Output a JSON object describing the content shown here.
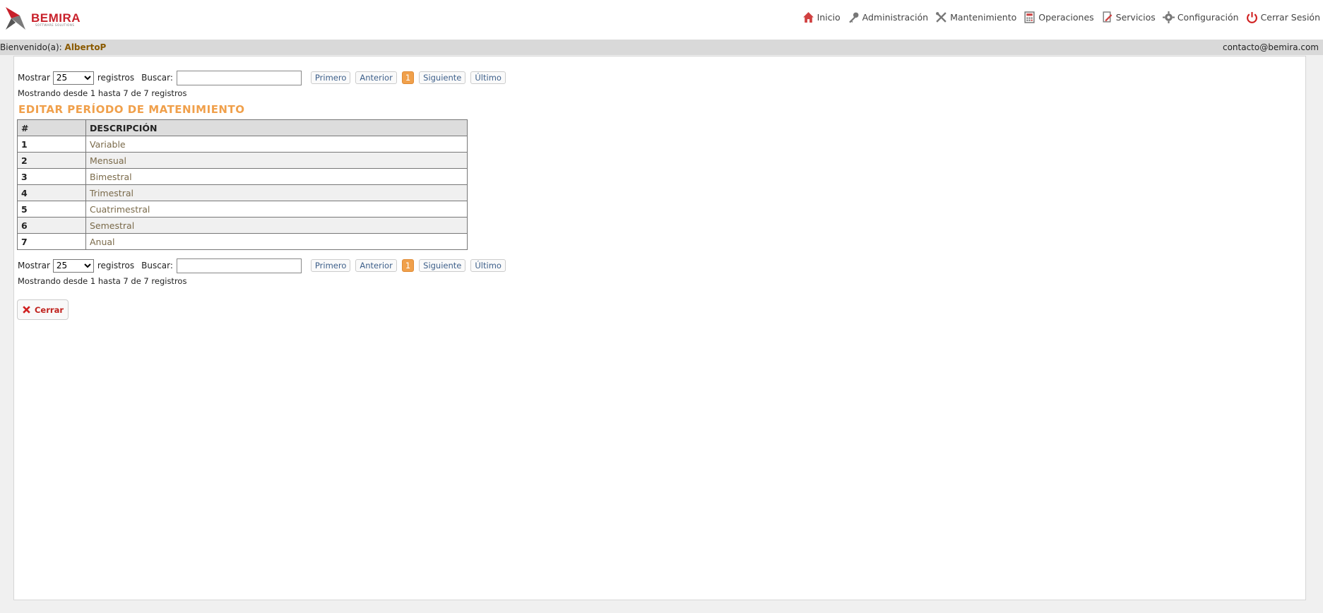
{
  "header": {
    "logo_text": "BEMIRA",
    "logo_subtitle": "SOFTWARE SOLUTIONS",
    "nav": [
      {
        "label": "Inicio",
        "icon": "home-icon"
      },
      {
        "label": "Administración",
        "icon": "key-icon"
      },
      {
        "label": "Mantenimiento",
        "icon": "tools-icon"
      },
      {
        "label": "Operaciones",
        "icon": "calculator-icon"
      },
      {
        "label": "Servicios",
        "icon": "document-edit-icon"
      },
      {
        "label": "Configuración",
        "icon": "gear-icon"
      },
      {
        "label": "Cerrar Sesión",
        "icon": "power-icon"
      }
    ]
  },
  "welcome": {
    "prefix": "Bienvenido(a):",
    "user": "AlbertoP",
    "email": "contacto@bemira.com"
  },
  "controls": {
    "show_label": "Mostrar",
    "page_size": "25",
    "records_label": "registros",
    "search_label": "Buscar:",
    "search_value": "",
    "first": "Primero",
    "prev": "Anterior",
    "current_page": "1",
    "next": "Siguiente",
    "last": "Último",
    "info": "Mostrando desde 1 hasta 7 de 7 registros"
  },
  "title": "EDITAR PERÍODO DE MATENIMIENTO",
  "table": {
    "headers": [
      "#",
      "DESCRIPCIÓN"
    ],
    "rows": [
      {
        "id": "1",
        "desc": "Variable"
      },
      {
        "id": "2",
        "desc": "Mensual"
      },
      {
        "id": "3",
        "desc": "Bimestral"
      },
      {
        "id": "4",
        "desc": "Trimestral"
      },
      {
        "id": "5",
        "desc": "Cuatrimestral"
      },
      {
        "id": "6",
        "desc": "Semestral"
      },
      {
        "id": "7",
        "desc": "Anual"
      }
    ]
  },
  "close_button": "Cerrar",
  "colors": {
    "accent": "#f0a04b",
    "brand": "#c8202a",
    "link": "#7a6a4a"
  }
}
